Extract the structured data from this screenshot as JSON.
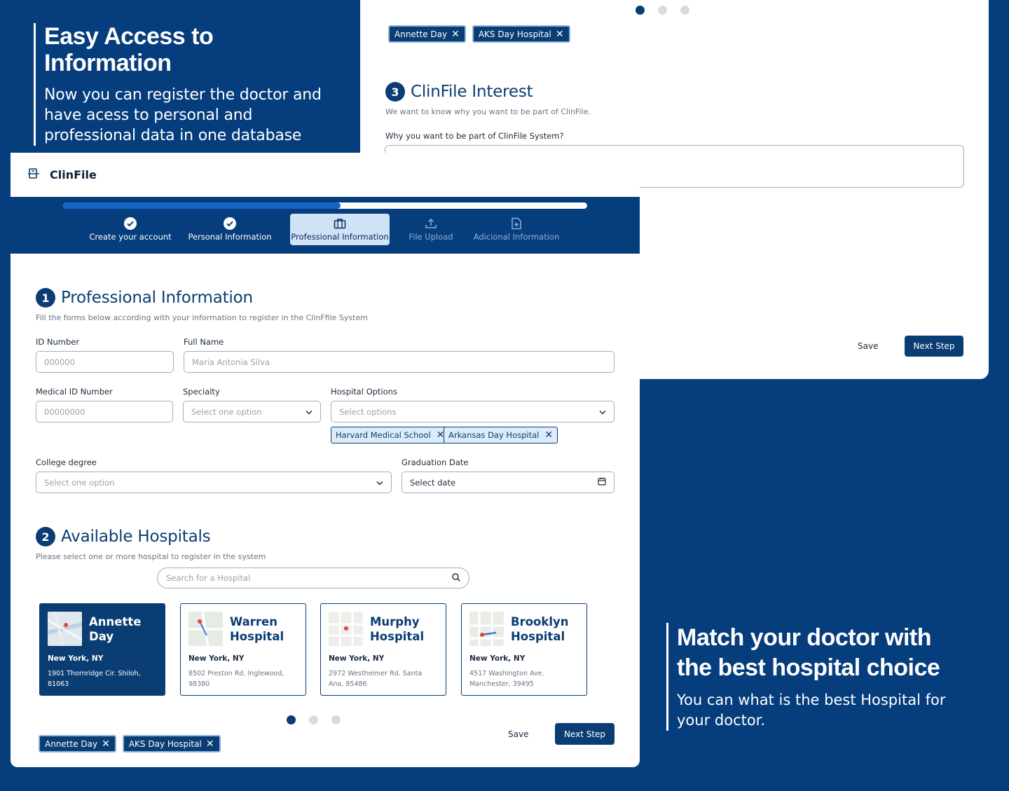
{
  "promo_top": {
    "title": "Easy Access to Information",
    "body": "Now you can register the doctor and have acess to personal and professional data in one database"
  },
  "promo_bottom": {
    "title": "Match your doctor with the best hospital choice",
    "body": "You can what is the best Hospital for your doctor."
  },
  "back_card": {
    "chips": [
      "Annette Day",
      "AKS Day Hospital"
    ],
    "section_number": "3",
    "section_title": "ClinFile Interest",
    "section_subtitle": "We want to know why you want to be part of ClinFile.",
    "question_label": "Why you want to be part of ClinFile System?",
    "save_label": "Save",
    "next_label": "Next Step"
  },
  "app": {
    "brand": "ClinFile",
    "progress_fraction": 0.53,
    "steps": [
      {
        "label": "Create your account",
        "status": "done"
      },
      {
        "label": "Personal Information",
        "status": "done"
      },
      {
        "label": "Professional Information",
        "status": "current"
      },
      {
        "label": "File Upload",
        "status": "pending"
      },
      {
        "label": "Adicional Information",
        "status": "pending"
      }
    ]
  },
  "professional": {
    "number": "1",
    "title": "Professional Information",
    "subtitle": "Fill the forms below according with your information to register in the ClinFfile System",
    "id_number": {
      "label": "ID Number",
      "placeholder": "000000"
    },
    "full_name": {
      "label": "Full Name",
      "placeholder": "Maria Antonia Silva"
    },
    "medical_id": {
      "label": "Medical ID Number",
      "placeholder": "00000000"
    },
    "specialty": {
      "label": "Specialty",
      "placeholder": "Select one option"
    },
    "hospital_options": {
      "label": "Hospital Options",
      "placeholder": "Select options",
      "selected": [
        "Harvard Medical School",
        "Arkansas Day Hospital"
      ]
    },
    "college_degree": {
      "label": "College degree",
      "placeholder": "Select one option"
    },
    "graduation_date": {
      "label": "Graduation Date",
      "value": "Select date"
    }
  },
  "hospitals": {
    "number": "2",
    "title": "Available Hospitals",
    "subtitle": "Please select one or more hospital to register in the system",
    "search_placeholder": "Search for a Hospital",
    "cards": [
      {
        "name": "Annette Day",
        "city": "New York, NY",
        "address": "1901 Thornridge Cir. Shiloh, 81063",
        "selected": true
      },
      {
        "name": "Warren Hospital",
        "city": "New York, NY",
        "address": "8502 Preston Rd. Inglewood, 98380",
        "selected": false
      },
      {
        "name": "Murphy Hospital",
        "city": "New York, NY",
        "address": "2972 Westheimer Rd. Santa Ana, 85486",
        "selected": false
      },
      {
        "name": "Brooklyn Hospital",
        "city": "New York, NY",
        "address": "4517 Washington Ave. Manchester, 39495",
        "selected": false
      }
    ],
    "chips": [
      "Annette Day",
      "AKS Day Hospital"
    ],
    "save_label": "Save",
    "next_label": "Next Step"
  },
  "colors": {
    "navy": "#063d7c",
    "primary": "#0a3d73",
    "progress": "#1565c8",
    "current_step_bg": "#cfe2f6"
  },
  "icons": [
    "file-logo-icon",
    "check-circle-icon",
    "briefcase-icon",
    "upload-icon",
    "file-plus-icon",
    "chevron-down-icon",
    "calendar-icon",
    "search-icon",
    "close-icon",
    "map-thumbnail-icon"
  ]
}
